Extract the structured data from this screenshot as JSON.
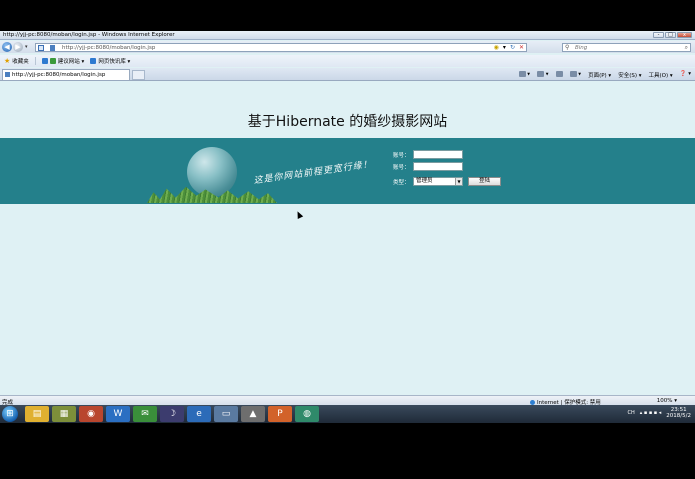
{
  "window": {
    "title": "http://yjj-pc:8080/moban/login.jsp - Windows Internet Explorer",
    "buttons": [
      "-",
      "□",
      "x"
    ]
  },
  "addressbar": {
    "url": "http://yjj-pc:8080/moban/login.jsp",
    "search_placeholder": "Bing",
    "back_glyph": "◀",
    "forward_glyph": "▶"
  },
  "favorites": {
    "label": "收藏夹",
    "items": [
      "建议网站 ▾",
      "网页快讯库 ▾"
    ]
  },
  "tab": {
    "label": "http://yjj-pc:8080/moban/login.jsp"
  },
  "commands": [
    "页面(P) ▾",
    "安全(S) ▾",
    "工具(O) ▾",
    "❓ ▾"
  ],
  "page": {
    "title": "基于Hibernate 的婚纱摄影网站",
    "slogan": "这是你网站前程更宽行缘！",
    "form": {
      "account_label": "账号：",
      "password_label": "账号：",
      "type_label": "类型：",
      "type_selected": "管理员",
      "login_button": "登陆"
    }
  },
  "statusbar": {
    "left": "完成",
    "zone": "Internet | 保护模式: 禁用",
    "zoom": "100% ▾"
  },
  "taskbar": {
    "time": "23:51",
    "date": "2018/5/2",
    "lang": "CH",
    "apps": [
      "explorer",
      "chrome",
      "word",
      "wechat",
      "eclipse",
      "ie",
      "file",
      "app",
      "ppt",
      "network"
    ]
  },
  "colors": {
    "page_bg": "#dff1f4",
    "band": "#24808b"
  }
}
